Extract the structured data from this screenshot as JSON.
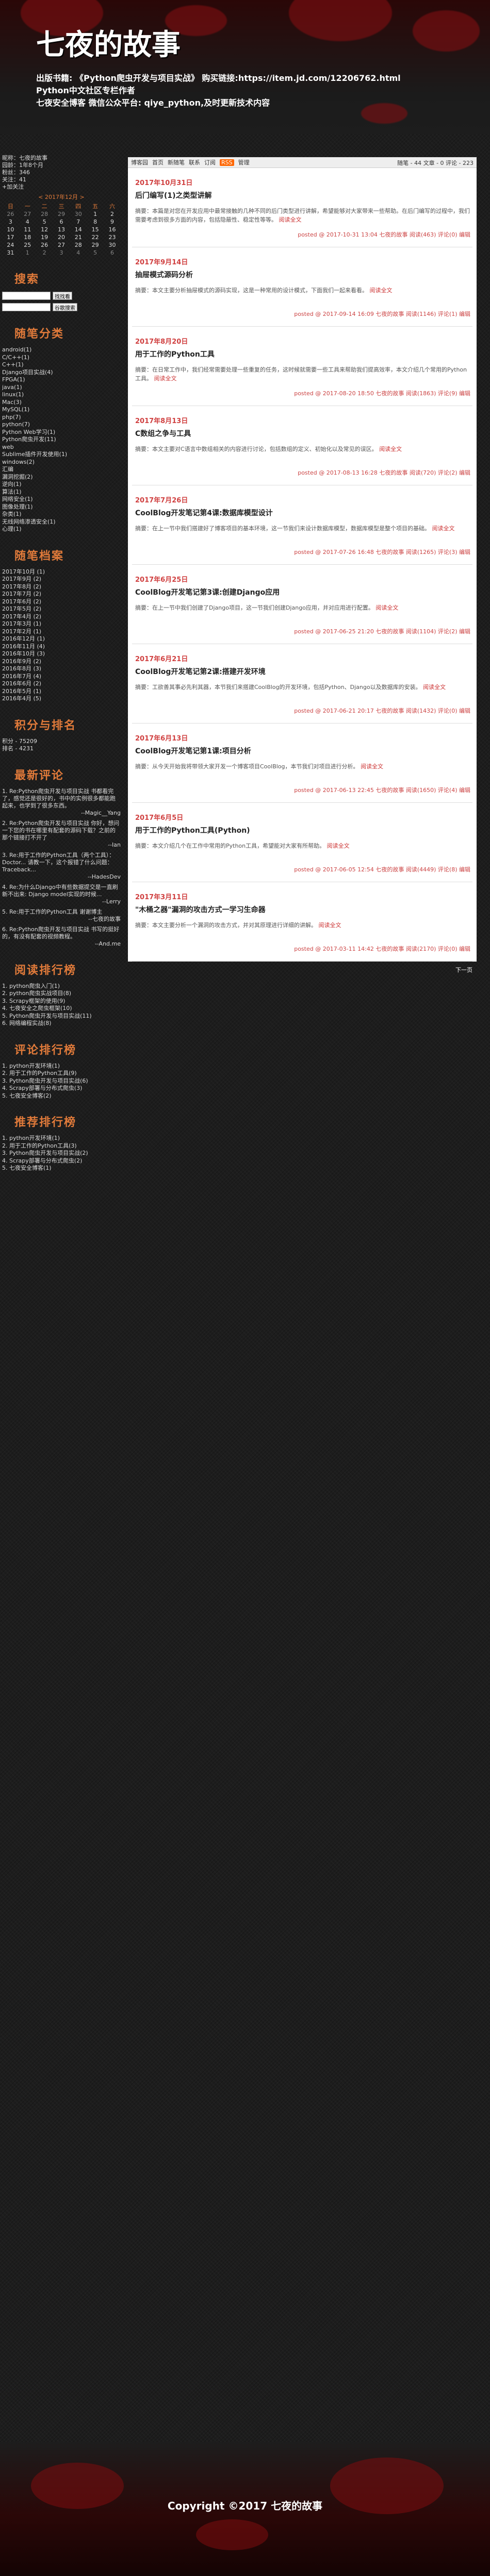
{
  "header": {
    "title": "七夜的故事",
    "desc_line1": "出版书籍: 《Python爬虫开发与项目实战》 购买链接:https://item.jd.com/12206762.html",
    "desc_line2": "Python中文社区专栏作者",
    "desc_line3": "七夜安全博客 微信公众平台: qiye_python,及时更新技术内容"
  },
  "sidebar": {
    "info": [
      "昵称：七夜的故事",
      "园龄：1年8个月",
      "粉丝：346",
      "关注：41",
      "+加关注"
    ],
    "calendar": {
      "caption": "< 2017年12月 >",
      "weekdays": [
        "日",
        "一",
        "二",
        "三",
        "四",
        "五",
        "六"
      ],
      "rows": [
        [
          "26",
          "27",
          "28",
          "29",
          "30",
          "1",
          "2"
        ],
        [
          "3",
          "4",
          "5",
          "6",
          "7",
          "8",
          "9"
        ],
        [
          "10",
          "11",
          "12",
          "13",
          "14",
          "15",
          "16"
        ],
        [
          "17",
          "18",
          "19",
          "20",
          "21",
          "22",
          "23"
        ],
        [
          "24",
          "25",
          "26",
          "27",
          "28",
          "29",
          "30"
        ],
        [
          "31",
          "1",
          "2",
          "3",
          "4",
          "5",
          "6"
        ]
      ]
    },
    "search_title": "搜索",
    "search_button": "找找看",
    "search_button2": "谷歌搜索",
    "categories_title": "随笔分类",
    "categories": [
      "android(1)",
      "C/C++(1)",
      "C++(1)",
      "Django项目实战(4)",
      "FPGA(1)",
      "java(1)",
      "linux(1)",
      "Mac(3)",
      "MySQL(1)",
      "php(7)",
      "python(7)",
      "Python Web学习(1)",
      "Python爬虫开发(11)",
      "web",
      "Sublime插件开发使用(1)",
      "windows(2)",
      "汇编",
      "漏洞挖掘(2)",
      "逆向(1)",
      "算法(1)",
      "网络安全(1)",
      "图像处理(1)",
      "杂类(1)",
      "无线网络渗透安全(1)",
      "心理(1)"
    ],
    "archive_title": "随笔档案",
    "archives": [
      "2017年10月 (1)",
      "2017年9月 (2)",
      "2017年8月 (2)",
      "2017年7月 (2)",
      "2017年6月 (2)",
      "2017年5月 (2)",
      "2017年4月 (2)",
      "2017年3月 (1)",
      "2017年2月 (1)",
      "2016年12月 (1)",
      "2016年11月 (4)",
      "2016年10月 (3)",
      "2016年9月 (2)",
      "2016年8月 (3)",
      "2016年7月 (4)",
      "2016年6月 (2)",
      "2016年5月 (1)",
      "2016年4月 (5)"
    ],
    "score_title": "积分与排名",
    "score": [
      "积分 - 75209",
      "排名 - 4231"
    ],
    "recent_comments_title": "最新评论",
    "comments": [
      {
        "text": "1. Re:Python爬虫开发与项目实战 书都看完了，感觉还是很好的，书中的实例很多都能跑起来，也学到了很多东西。",
        "author": "--Magic__Yang"
      },
      {
        "text": "2. Re:Python爬虫开发与项目实战 你好，想问一下您的书在哪里有配套的源码下载？之前的那个链接打不开了",
        "author": "--Ian"
      },
      {
        "text": "3. Re:用于工作的Python工具（两个工具）：Doctor... 请教一下，这个报错了什么问题：Traceback...",
        "author": "--HadesDev"
      },
      {
        "text": "4. Re:为什么Django中有些数据提交是一直刷新不出来: Django model实现的时候...",
        "author": "--Lerry"
      },
      {
        "text": "5. Re:用于工作的Python工具 谢谢博主",
        "author": "--七夜的故事"
      },
      {
        "text": "6. Re:Python爬虫开发与项目实战 书写的挺好的，有没有配套的视频教程。",
        "author": "--And.me"
      }
    ],
    "read_rank_title": "阅读排行榜",
    "read_rank": [
      "1. python爬虫入门(1)",
      "2. python爬虫实战项目(8)",
      "3. Scrapy框架的使用(9)",
      "4. 七夜安全之爬虫框架(10)",
      "5. Python爬虫开发与项目实战(11)",
      "6. 网络编程实战(8)"
    ],
    "comment_rank_title": "评论排行榜",
    "comment_rank": [
      "1. python开发环境(1)",
      "2. 用于工作的Python工具(9)",
      "3. Python爬虫开发与项目实战(6)",
      "4. Scrapy部署与分布式爬虫(3)",
      "5. 七夜安全博客(2)"
    ],
    "recommend_rank_title": "推荐排行榜",
    "recommend_rank": [
      "1. python开发环境(1)",
      "2. 用于工作的Python工具(3)",
      "3. Python爬虫开发与项目实战(2)",
      "4. Scrapy部署与分布式爬虫(2)",
      "5. 七夜安全博客(1)"
    ]
  },
  "main": {
    "nav": [
      "博客园",
      "首页",
      "新随笔",
      "联系",
      "订阅",
      "管理"
    ],
    "rss": "RSS",
    "stats": "随笔 - 44  文章 - 0  评论 - 223",
    "posts": [
      {
        "date": "2017年10月31日",
        "title": "后门编写(1)之类型讲解",
        "summary": "摘要：本篇是对您在开发应用中最常接触的几种不同的后门类型进行讲解，希望能够对大家带来一些帮助。在后门编写的过程中，我们需要考虑到很多方面的内容，包括隐蔽性、稳定性等等。",
        "more": "阅读全文",
        "footer": "posted @ 2017-10-31 13:04 七夜的故事 阅读(463) 评论(0) 编辑"
      },
      {
        "date": "2017年9月14日",
        "title": "抽屉模式源码分析",
        "summary": "摘要：本文主要分析抽屉模式的源码实现，这是一种常用的设计模式，下面我们一起来看看。",
        "more": "阅读全文",
        "footer": "posted @ 2017-09-14 16:09 七夜的故事 阅读(1146) 评论(1) 编辑"
      },
      {
        "date": "2017年8月20日",
        "title": "用于工作的Python工具",
        "summary": "摘要：在日常工作中，我们经常需要处理一些重复的任务，这时候就需要一些工具来帮助我们提高效率，本文介绍几个常用的Python工具。",
        "more": "阅读全文",
        "footer": "posted @ 2017-08-20 18:50 七夜的故事 阅读(1863) 评论(9) 编辑"
      },
      {
        "date": "2017年8月13日",
        "title": "C数组之争与工具",
        "summary": "摘要：本文主要对C语言中数组相关的内容进行讨论，包括数组的定义、初始化以及常见的误区。",
        "more": "阅读全文",
        "footer": "posted @ 2017-08-13 16:28 七夜的故事 阅读(720) 评论(2) 编辑"
      },
      {
        "date": "2017年7月26日",
        "title": "CoolBlog开发笔记第4课:数据库模型设计",
        "summary": "摘要：在上一节中我们搭建好了博客项目的基本环境，这一节我们来设计数据库模型，数据库模型是整个项目的基础。",
        "more": "阅读全文",
        "footer": "posted @ 2017-07-26 16:48 七夜的故事 阅读(1265) 评论(3) 编辑"
      },
      {
        "date": "2017年6月25日",
        "title": "CoolBlog开发笔记第3课:创建Django应用",
        "summary": "摘要：在上一节中我们创建了Django项目，这一节我们创建Django应用，并对应用进行配置。",
        "more": "阅读全文",
        "footer": "posted @ 2017-06-25 21:20 七夜的故事 阅读(1104) 评论(2) 编辑"
      },
      {
        "date": "2017年6月21日",
        "title": "CoolBlog开发笔记第2课:搭建开发环境",
        "summary": "摘要：工欲善其事必先利其器，本节我们来搭建CoolBlog的开发环境，包括Python、Django以及数据库的安装。",
        "more": "阅读全文",
        "footer": "posted @ 2017-06-21 20:17 七夜的故事 阅读(1432) 评论(0) 编辑"
      },
      {
        "date": "2017年6月13日",
        "title": "CoolBlog开发笔记第1课:项目分析",
        "summary": "摘要：从今天开始我将带领大家开发一个博客项目CoolBlog，本节我们对项目进行分析。",
        "more": "阅读全文",
        "footer": "posted @ 2017-06-13 22:45 七夜的故事 阅读(1650) 评论(4) 编辑"
      },
      {
        "date": "2017年6月5日",
        "title": "用于工作的Python工具(Python)",
        "summary": "摘要：本文介绍几个在工作中常用的Python工具，希望能对大家有所帮助。",
        "more": "阅读全文",
        "footer": "posted @ 2017-06-05 12:54 七夜的故事 阅读(4449) 评论(8) 编辑"
      },
      {
        "date": "2017年3月11日",
        "title": "\"木桶之器\"漏洞的攻击方式一学习生命器",
        "summary": "摘要：本文主要分析一个漏洞的攻击方式，并对其原理进行详细的讲解。",
        "more": "阅读全文",
        "footer": "posted @ 2017-03-11 14:42 七夜的故事 阅读(2170) 评论(0) 编辑"
      }
    ],
    "pager": "下一页"
  },
  "footer": {
    "copyright": "Copyright ©2017 七夜的故事"
  }
}
